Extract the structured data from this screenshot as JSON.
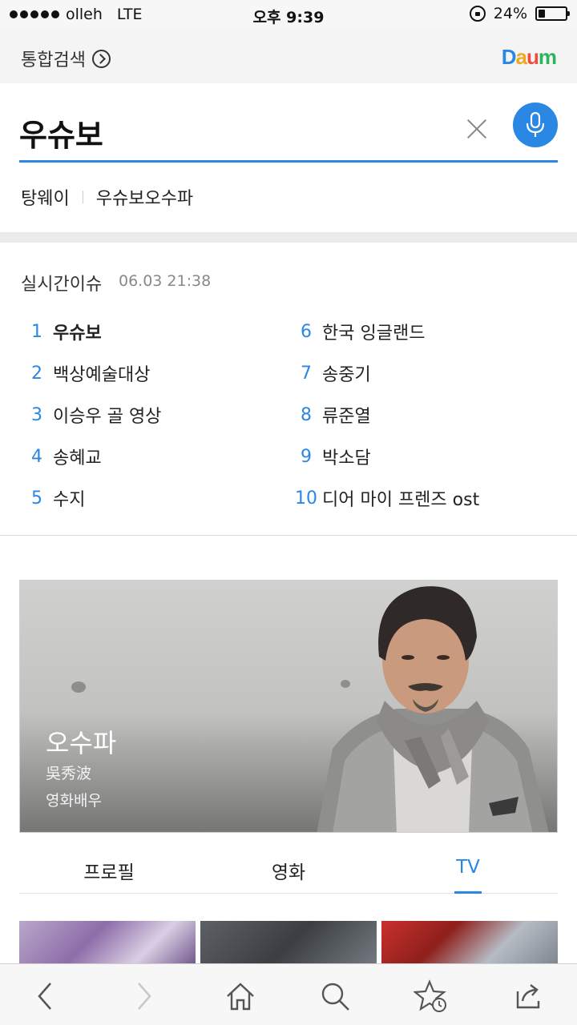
{
  "status_bar": {
    "carrier": "olleh",
    "network": "LTE",
    "time": "오후 9:39",
    "battery": "24%",
    "battery_level": 0.24
  },
  "header": {
    "total_search_label": "통합검색",
    "logo_text": "Daum",
    "logo_colors": [
      "#2a87e4",
      "#f0a81f",
      "#ef4c3d",
      "#2cb45a",
      "#7b4fd6"
    ]
  },
  "search": {
    "query": "우슈보",
    "related": [
      "탕웨이",
      "우슈보오수파"
    ]
  },
  "realtime": {
    "title": "실시간이슈",
    "timestamp": "06.03 21:38",
    "items": [
      {
        "rank": "1",
        "keyword": "우슈보"
      },
      {
        "rank": "2",
        "keyword": "백상예술대상"
      },
      {
        "rank": "3",
        "keyword": "이승우 골 영상"
      },
      {
        "rank": "4",
        "keyword": "송혜교"
      },
      {
        "rank": "5",
        "keyword": "수지"
      },
      {
        "rank": "6",
        "keyword": "한국 잉글랜드"
      },
      {
        "rank": "7",
        "keyword": "송중기"
      },
      {
        "rank": "8",
        "keyword": "류준열"
      },
      {
        "rank": "9",
        "keyword": "박소담"
      },
      {
        "rank": "10",
        "keyword": "디어 마이 프렌즈 ost"
      }
    ]
  },
  "profile": {
    "name": "오수파",
    "hanja": "吳秀波",
    "job": "영화배우"
  },
  "tabs": [
    {
      "label": "프로필",
      "active": false
    },
    {
      "label": "영화",
      "active": false
    },
    {
      "label": "TV",
      "active": true
    }
  ],
  "toolbar": {
    "icons": [
      "back-icon",
      "forward-icon",
      "home-icon",
      "search-icon",
      "bookmark-history-icon",
      "share-icon"
    ]
  },
  "colors": {
    "accent": "#2a87e4",
    "rank_number": "#2a87e4"
  }
}
